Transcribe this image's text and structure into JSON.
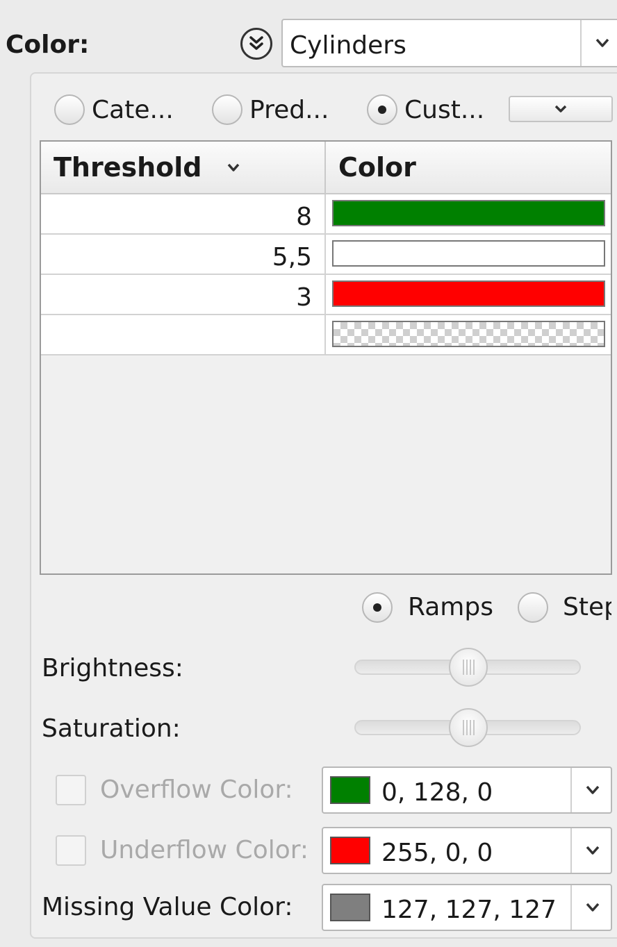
{
  "color_row": {
    "label": "Color:",
    "selected": "Cylinders"
  },
  "mode": {
    "options": [
      "Cate...",
      "Pred...",
      "Cust..."
    ],
    "selected": "Cust..."
  },
  "table": {
    "columns": [
      "Threshold",
      "Color"
    ],
    "rows": [
      {
        "threshold": "8",
        "color": "#008000"
      },
      {
        "threshold": "5,5",
        "color": "#ffffff"
      },
      {
        "threshold": "3",
        "color": "#ff0000"
      },
      {
        "threshold": "",
        "color": "transparent"
      }
    ]
  },
  "interpolation": {
    "options": [
      "Ramps",
      "Step"
    ],
    "selected": "Ramps"
  },
  "sliders": {
    "brightness_label": "Brightness:",
    "saturation_label": "Saturation:",
    "brightness_value": 0.5,
    "saturation_value": 0.5
  },
  "overflow": {
    "label": "Overflow Color:",
    "checked": false,
    "value": "0, 128, 0",
    "color": "#008000"
  },
  "underflow": {
    "label": "Underflow Color:",
    "checked": false,
    "value": "255, 0, 0",
    "color": "#ff0000"
  },
  "missing": {
    "label": "Missing Value Color:",
    "value": "127, 127, 127",
    "color": "#7f7f7f"
  }
}
